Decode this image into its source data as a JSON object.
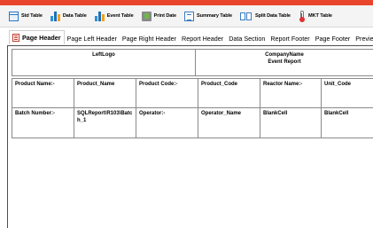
{
  "toolbar": {
    "items": [
      {
        "label": "Std Table",
        "icon": "std-table-icon"
      },
      {
        "label": "Data Table",
        "icon": "data-table-icon"
      },
      {
        "label": "Event Table",
        "icon": "event-table-icon"
      },
      {
        "label": "Print Date",
        "icon": "print-date-icon"
      },
      {
        "label": "Summary Table",
        "icon": "summary-table-icon"
      },
      {
        "label": "Split Data Table",
        "icon": "split-data-table-icon"
      },
      {
        "label": "MKT Table",
        "icon": "thermometer-icon"
      }
    ]
  },
  "tabs": [
    {
      "label": "Page Header",
      "active": true
    },
    {
      "label": "Page Left Header"
    },
    {
      "label": "Page Right Header"
    },
    {
      "label": "Report Header"
    },
    {
      "label": "Data Section"
    },
    {
      "label": "Report Footer"
    },
    {
      "label": "Page Footer"
    },
    {
      "label": "Preview"
    }
  ],
  "header": {
    "left_logo": "LeftLogo",
    "company_name": "CompanyName",
    "event_report": "Event Report"
  },
  "grid": {
    "rows": [
      [
        "Product Name:-",
        "Product_Name",
        "Product Code:-",
        "Product_Code",
        "Reactor Name:-",
        "Unit_Code"
      ],
      [
        "Batch Number:-",
        "SQLReport\\R103\\Batch_1",
        "Operator:-",
        "Operator_Name",
        "BlankCell",
        "BlankCell"
      ]
    ]
  },
  "colors": {
    "accent_bar": "#e8452c"
  }
}
